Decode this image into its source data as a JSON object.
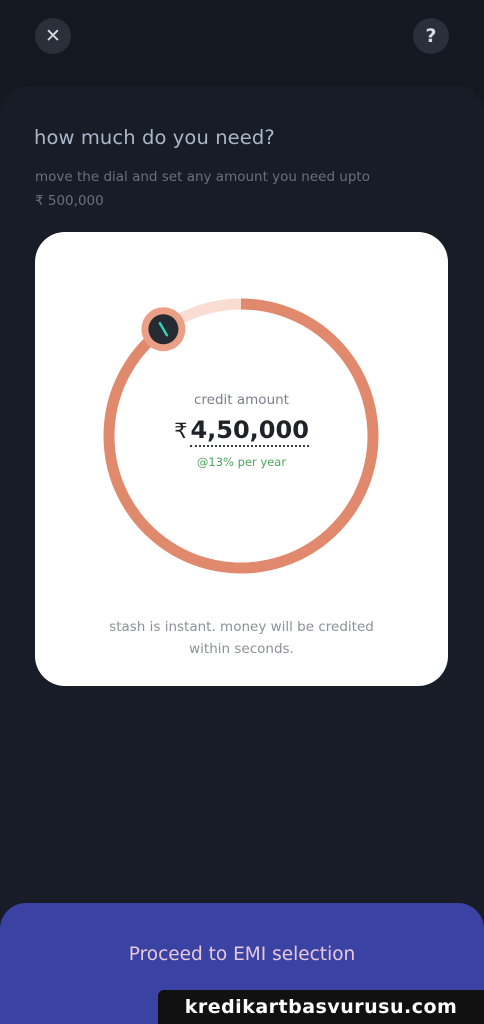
{
  "header": {
    "close_icon": "close-icon",
    "close_glyph": "✕",
    "help_icon": "help-icon",
    "help_glyph": "?"
  },
  "content": {
    "title": "how much do you need?",
    "subtitle_line1": "move the dial and set any amount you need upto",
    "subtitle_line2": "₹ 500,000"
  },
  "dial": {
    "label": "credit amount",
    "currency_symbol": "₹",
    "amount": "4,50,000",
    "rate": "@13% per year",
    "max_amount": 500000,
    "selected_fraction": 0.9,
    "handle_icon": "dial-handle-icon",
    "colors": {
      "track_filled": "#e0896d",
      "track_remaining": "#f9ddd3",
      "handle_ring": "#eb9f85",
      "handle_center": "#262a31",
      "handle_mark": "#2fd2bb"
    }
  },
  "card": {
    "note_line1": "stash is instant. money will be credited",
    "note_line2": "within seconds."
  },
  "footer": {
    "proceed_label": "Proceed to EMI selection",
    "watermark": "kredikartbasvurusu.com"
  },
  "colors": {
    "background": "#141821",
    "sheet": "#171c26",
    "proceed_bg": "#3a43a3",
    "proceed_text": "#e8c8da",
    "rate_green": "#4fa55c"
  }
}
